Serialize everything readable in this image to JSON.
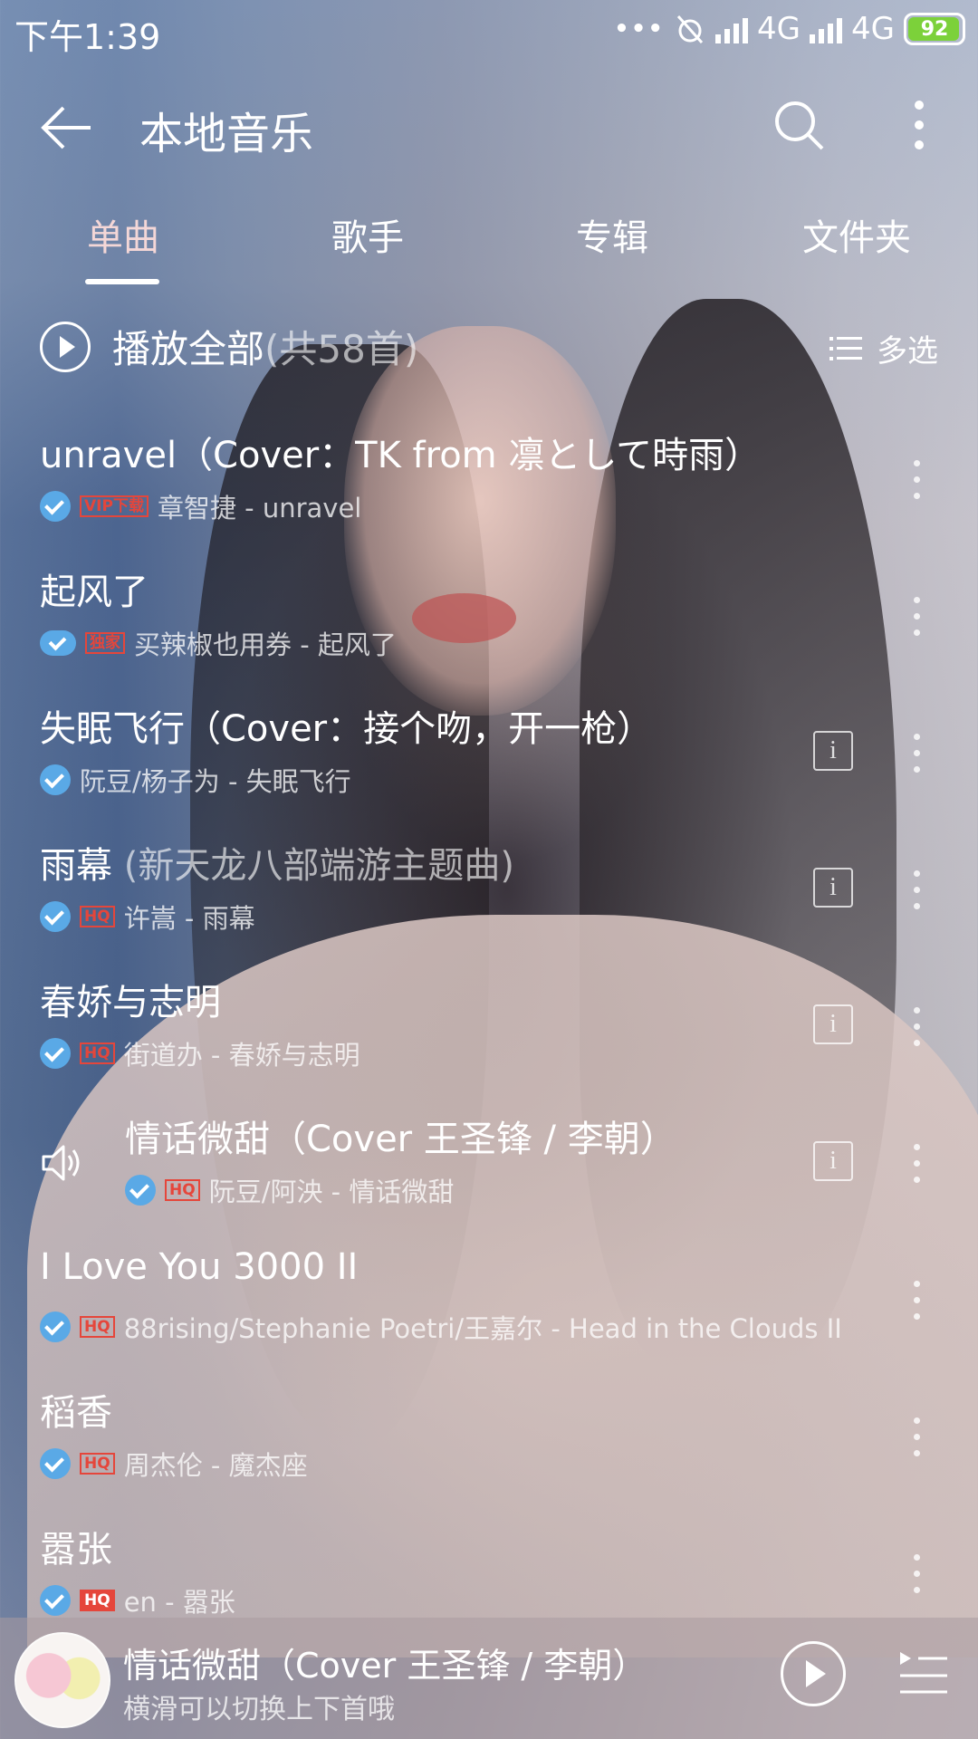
{
  "status": {
    "time": "下午1:39",
    "network1": "4G",
    "network2": "4G",
    "battery": "92"
  },
  "header": {
    "title": "本地音乐"
  },
  "tabs": [
    {
      "label": "单曲"
    },
    {
      "label": "歌手"
    },
    {
      "label": "专辑"
    },
    {
      "label": "文件夹"
    }
  ],
  "play_all": {
    "label": "播放全部",
    "count": "(共58首)",
    "multi_select": "多选"
  },
  "songs": [
    {
      "title": "unravel（Cover：TK from 凛として時雨）",
      "subtitle": "",
      "badge": "VIP下载",
      "artist_album": "章智捷 - unravel",
      "info": false
    },
    {
      "title": "起风了",
      "subtitle": "",
      "badge": "独家",
      "artist_album": "买辣椒也用券 - 起风了",
      "info": false
    },
    {
      "title": "失眠飞行（Cover：接个吻，开一枪）",
      "subtitle": "",
      "badge": "",
      "artist_album": "阮豆/杨子为 - 失眠飞行",
      "info": true
    },
    {
      "title": "雨幕 ",
      "subtitle": "(新天龙八部端游主题曲)",
      "badge": "HQ",
      "artist_album": "许嵩 - 雨幕",
      "info": true
    },
    {
      "title": "春娇与志明",
      "subtitle": "",
      "badge": "HQ",
      "artist_album": "街道办 - 春娇与志明",
      "info": true
    },
    {
      "title": "情话微甜（Cover 王圣锋 / 李朝）",
      "subtitle": "",
      "badge": "HQ",
      "artist_album": "阮豆/阿泱 - 情话微甜",
      "info": true
    },
    {
      "title": "I Love You 3000 II",
      "subtitle": "",
      "badge": "HQ",
      "artist_album": "88rising/Stephanie Poetri/王嘉尔 - Head in the Clouds II",
      "info": false
    },
    {
      "title": "稻香",
      "subtitle": "",
      "badge": "HQ",
      "artist_album": "周杰伦 - 魔杰座",
      "info": false
    },
    {
      "title": "嚣张",
      "subtitle": "",
      "badge": "HQ",
      "artist_album": "en - 嚣张",
      "info": false
    }
  ],
  "player": {
    "title": "情话微甜（Cover 王圣锋 / 李朝）",
    "hint": "横滑可以切换上下首哦"
  },
  "colors": {
    "accent_check": "#5aa9e6",
    "badge_red": "#e5463b",
    "battery_green": "#7cd13a",
    "active_tab": "#f4d7d7"
  },
  "icons": [
    "back-arrow-icon",
    "search-icon",
    "more-vertical-icon",
    "play-circle-icon",
    "list-icon",
    "check-icon",
    "cloud-check-icon",
    "info-icon",
    "speaker-icon",
    "play-icon",
    "queue-icon"
  ]
}
